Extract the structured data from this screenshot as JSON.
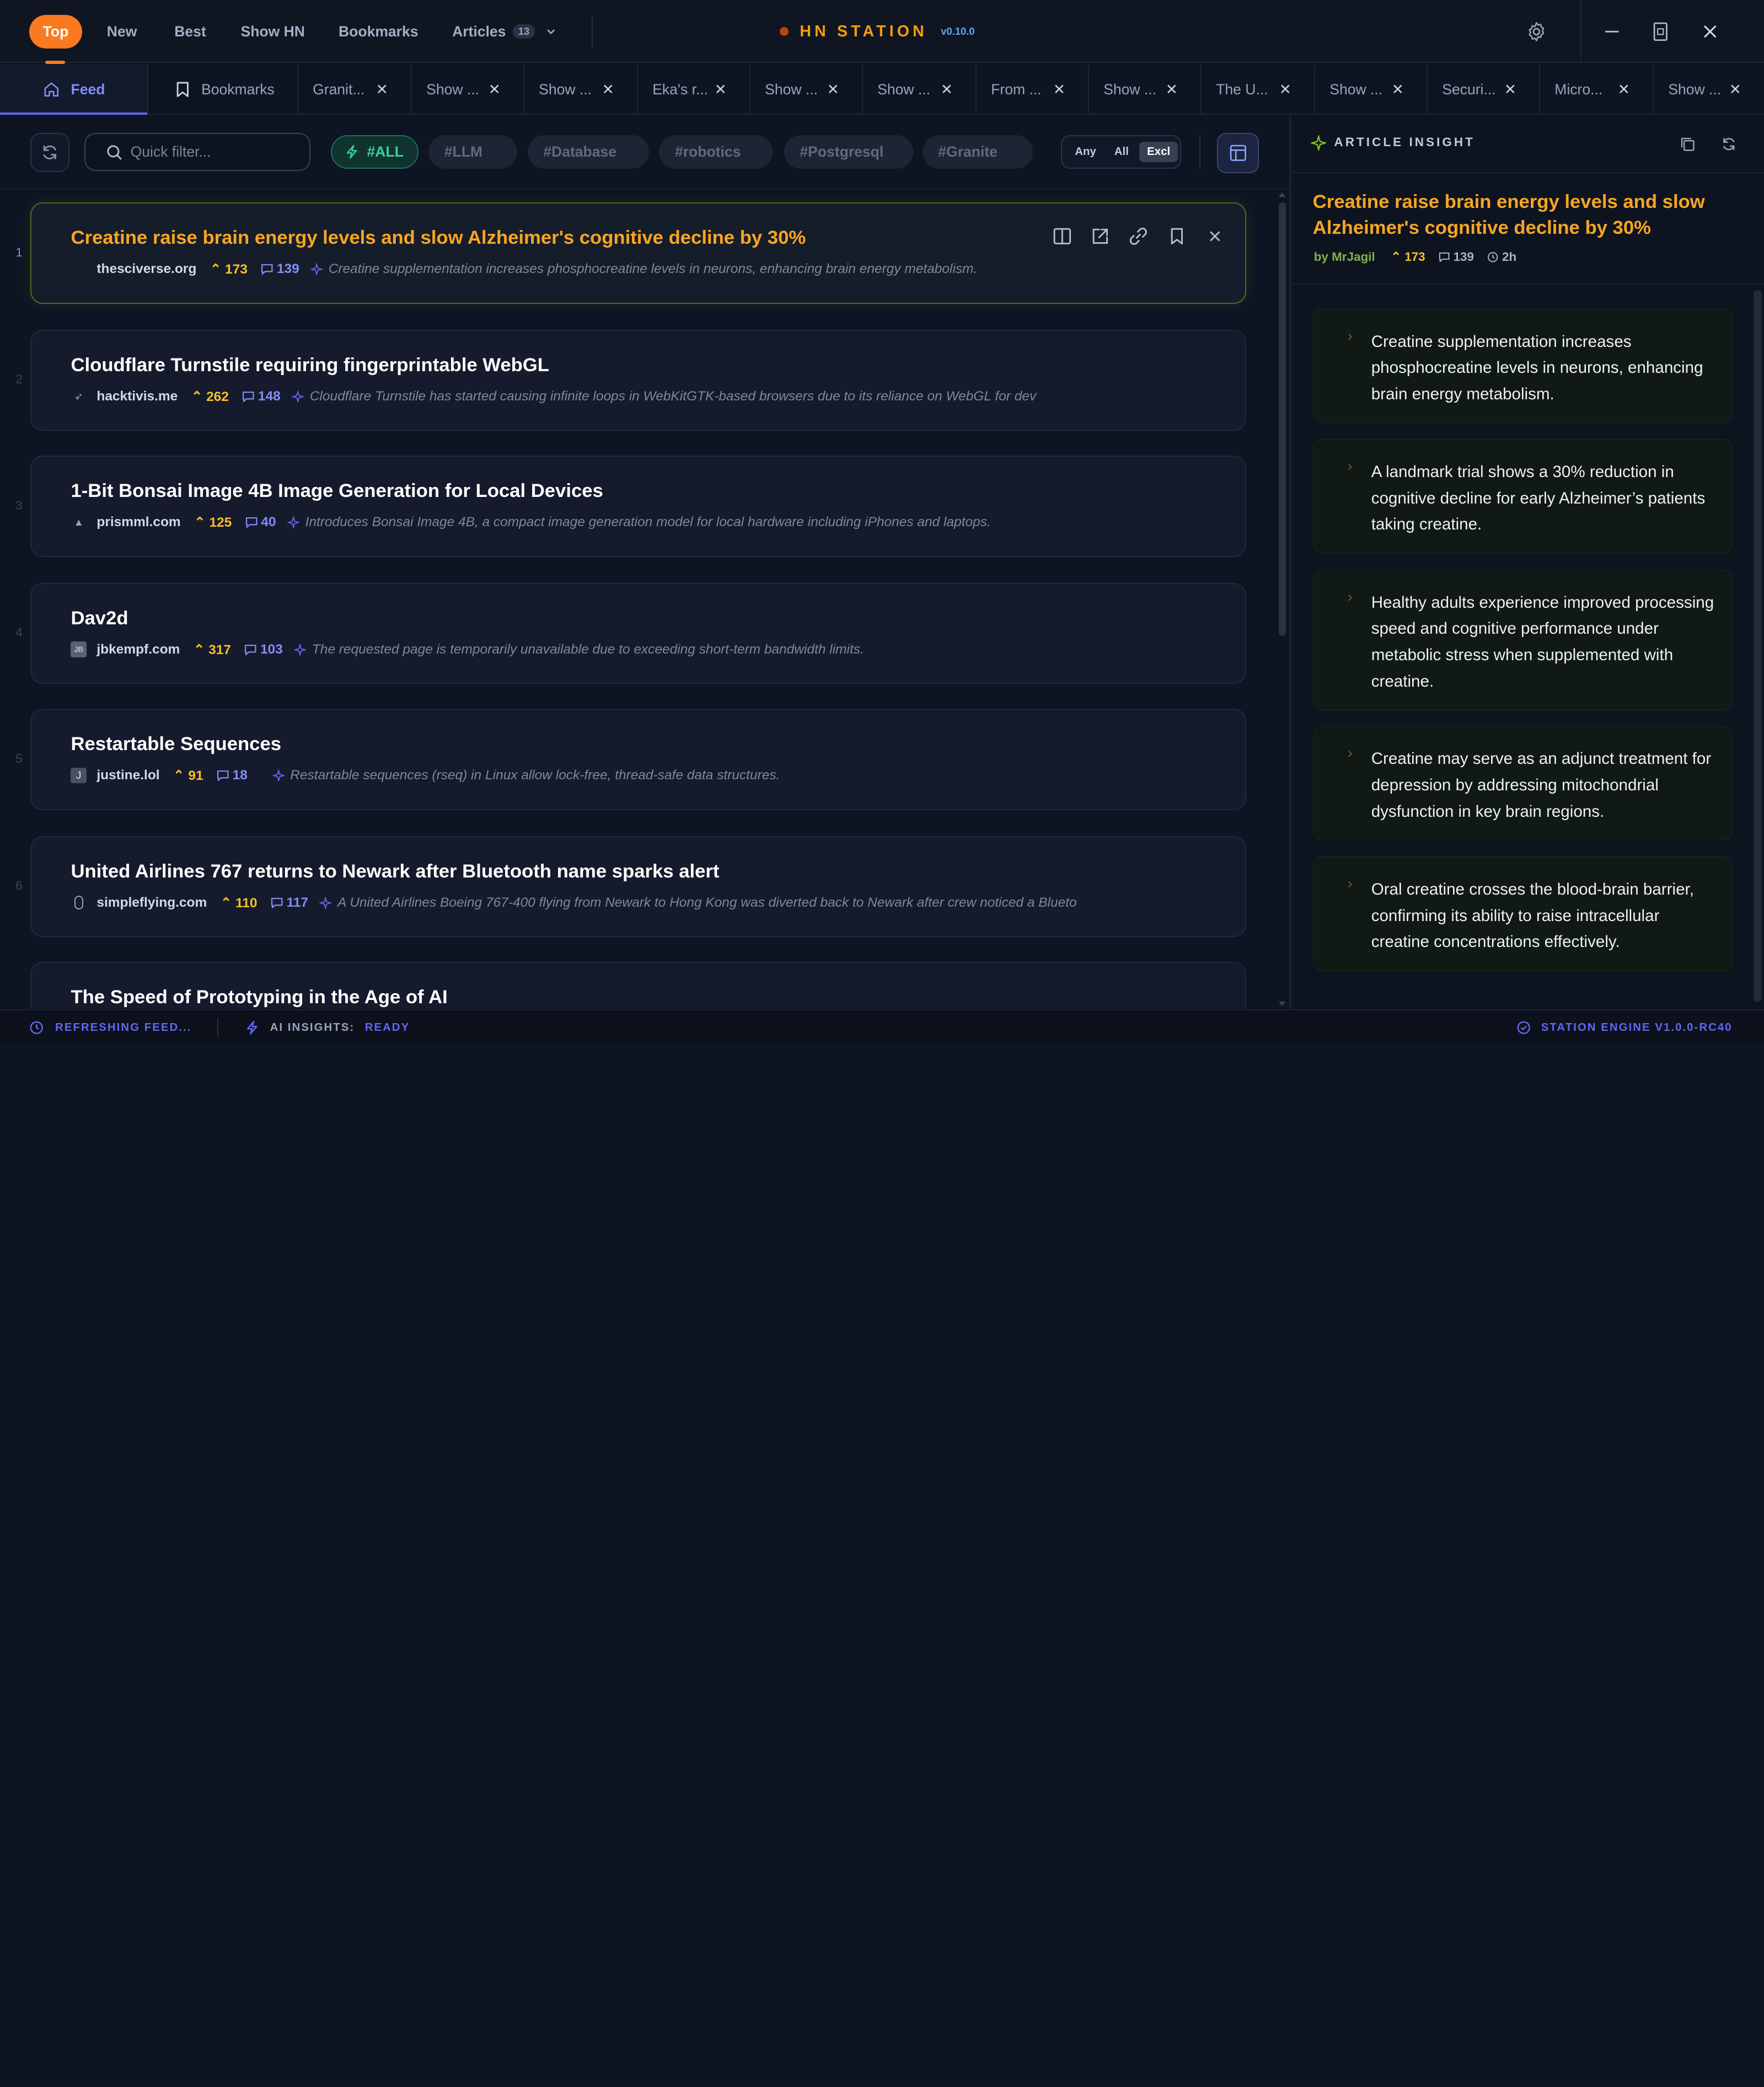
{
  "topnav": {
    "items": [
      {
        "label": "Top",
        "active": true
      },
      {
        "label": "New"
      },
      {
        "label": "Best"
      },
      {
        "label": "Show HN"
      },
      {
        "label": "Bookmarks"
      },
      {
        "label": "Articles",
        "count": "13"
      }
    ],
    "brand": "HN STATION",
    "version": "v0.10.0"
  },
  "tabs": [
    {
      "label": "Feed",
      "icon": "home-icon"
    },
    {
      "label": "Bookmarks",
      "icon": "bookmark-icon"
    },
    {
      "label": "Granit..."
    },
    {
      "label": "Show ..."
    },
    {
      "label": "Show ..."
    },
    {
      "label": "Eka's r..."
    },
    {
      "label": "Show ..."
    },
    {
      "label": "Show ..."
    },
    {
      "label": "From ..."
    },
    {
      "label": "Show ..."
    },
    {
      "label": "The U..."
    },
    {
      "label": "Show ..."
    },
    {
      "label": "Securi..."
    },
    {
      "label": "Micro..."
    },
    {
      "label": "Show ..."
    }
  ],
  "filter": {
    "search_placeholder": "Quick filter...",
    "chips": [
      "#ALL",
      "#LLM",
      "#Database",
      "#robotics",
      "#Postgresql",
      "#Granite"
    ],
    "modes": [
      "Any",
      "All",
      "Excl"
    ],
    "active_mode": "Excl"
  },
  "articles": [
    {
      "num": "1",
      "title": "Creatine raise brain energy levels and slow Alzheimer's cognitive decline by 30%",
      "domain": "thesciverse.org",
      "points": "173",
      "comments": "139",
      "summary": "Creatine supplementation increases phosphocreatine levels in neurons, enhancing brain energy metabolism.",
      "favicon": ""
    },
    {
      "num": "2",
      "title": "Cloudflare Turnstile requiring fingerprintable WebGL",
      "domain": "hacktivis.me",
      "points": "262",
      "comments": "148",
      "summary": "Cloudflare Turnstile has started causing infinite loops in WebKitGTK-based browsers due to its reliance on WebGL for dev",
      "favicon": ""
    },
    {
      "num": "3",
      "title": "1-Bit Bonsai Image 4B Image Generation for Local Devices",
      "domain": "prismml.com",
      "points": "125",
      "comments": "40",
      "summary": "Introduces Bonsai Image 4B, a compact image generation model for local hardware including iPhones and laptops.",
      "favicon": ""
    },
    {
      "num": "4",
      "title": "Dav2d",
      "domain": "jbkempf.com",
      "points": "317",
      "comments": "103",
      "summary": "The requested page is temporarily unavailable due to exceeding short-term bandwidth limits.",
      "favicon": "JB"
    },
    {
      "num": "5",
      "title": "Restartable Sequences",
      "domain": "justine.lol",
      "points": "91",
      "comments": "18",
      "summary": "Restartable sequences (rseq) in Linux allow lock-free, thread-safe data structures.",
      "favicon": "J"
    },
    {
      "num": "6",
      "title": "United Airlines 767 returns to Newark after Bluetooth name sparks alert",
      "domain": "simpleflying.com",
      "points": "110",
      "comments": "117",
      "summary": "A United Airlines Boeing 767-400 flying from Newark to Hong Kong was diverted back to Newark after crew noticed a Blueto",
      "favicon": ""
    },
    {
      "num": "7",
      "title": "The Speed of Prototyping in the Age of AI",
      "domain": "",
      "points": "",
      "comments": "",
      "summary": "",
      "favicon": ""
    }
  ],
  "insight": {
    "heading": "ARTICLE INSIGHT",
    "title": "Creatine raise brain energy levels and slow Alzheimer's cognitive decline by 30%",
    "author": "by MrJagil",
    "points": "173",
    "comments": "139",
    "age": "2h",
    "points_list": [
      "Creatine supplementation increases phosphocreatine levels in neurons, enhancing brain energy metabolism.",
      "A landmark trial shows a 30% reduction in cognitive decline for early Alzheimer’s patients taking creatine.",
      "Healthy adults experience improved processing speed and cognitive performance under metabolic stress when supplemented with creatine.",
      "Creatine may serve as an adjunct treatment for depression by addressing mitochondrial dysfunction in key brain regions.",
      "Oral creatine crosses the blood-brain barrier, confirming its ability to raise intracellular creatine concentrations effectively."
    ]
  },
  "status": {
    "refresh": "REFRESHING FEED...",
    "ai_label": "AI INSIGHTS:",
    "ai_value": "READY",
    "engine": "STATION ENGINE V1.0.0-RC40"
  },
  "colors": {
    "accent": "#f97a1f",
    "title_active": "#f6a623",
    "indigo": "#818cf8",
    "points": "#fbbf24",
    "ready": "#6366f1"
  }
}
